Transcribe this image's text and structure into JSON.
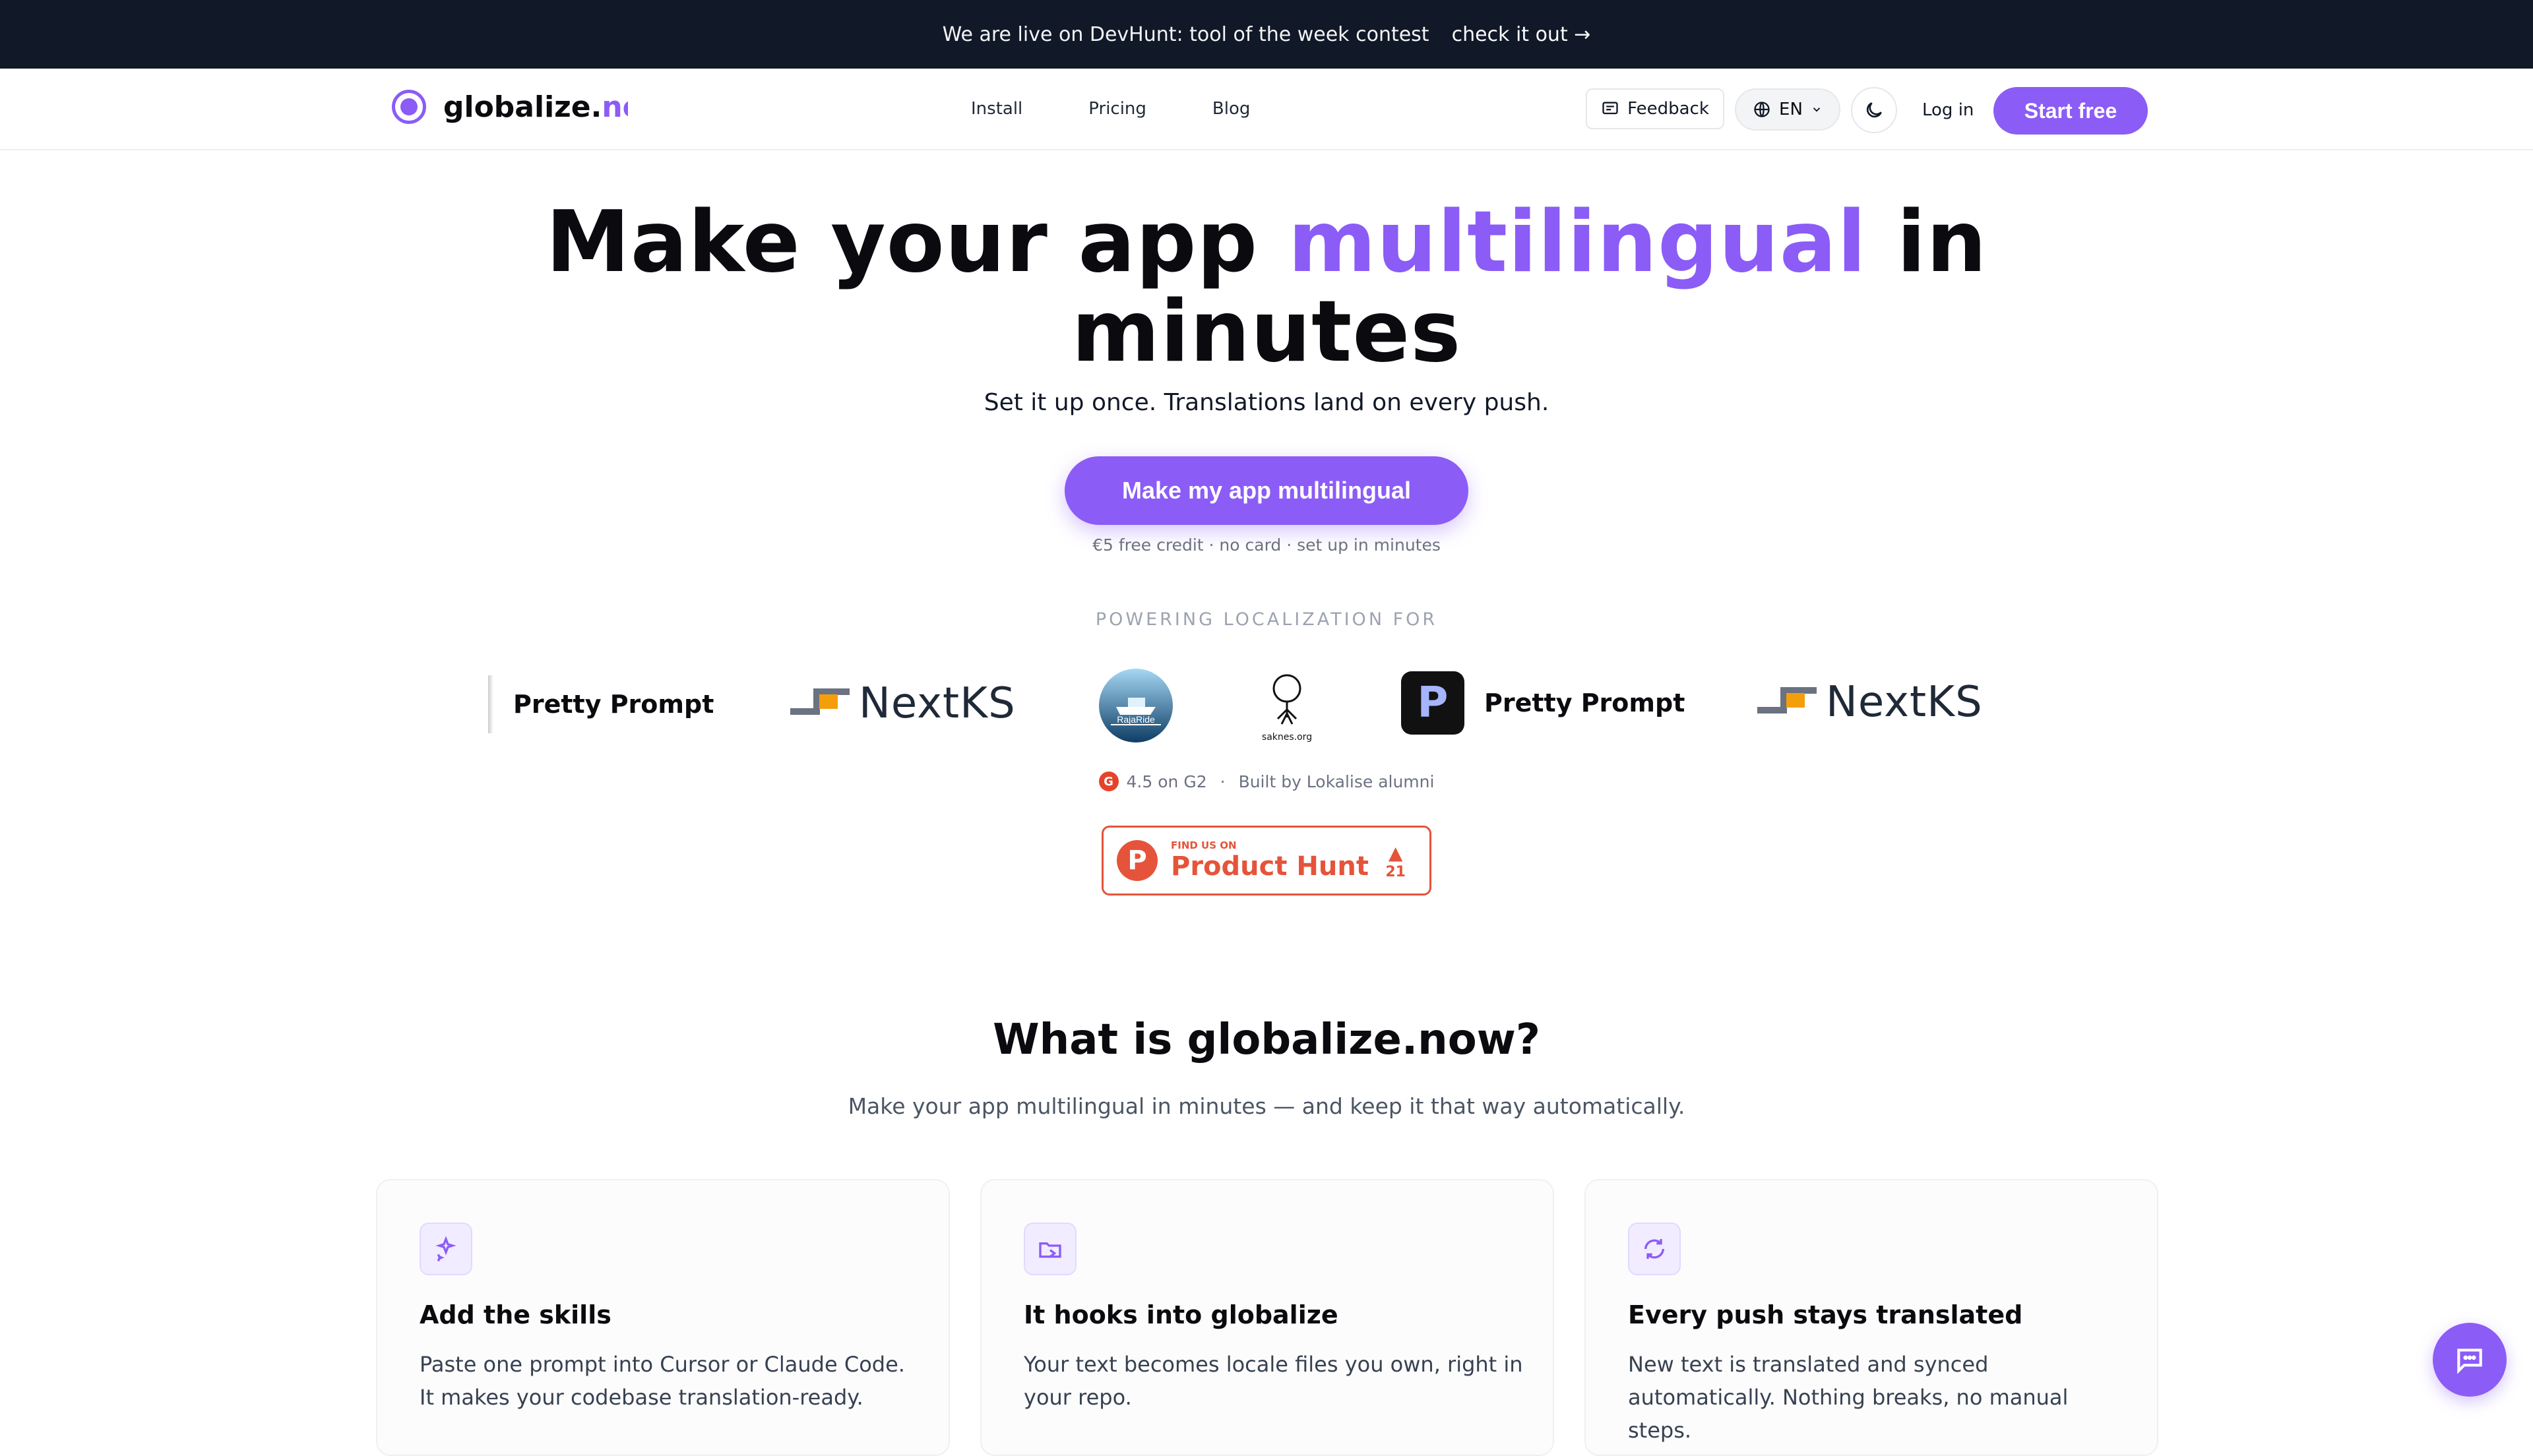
{
  "banner": {
    "text": "We are live on DevHunt: tool of the week contest",
    "link": "check it out →"
  },
  "nav": {
    "logo_text_main": "globalize.",
    "logo_text_accent": "now",
    "links": [
      "Install",
      "Pricing",
      "Blog"
    ],
    "feedback": "Feedback",
    "language": "EN",
    "login": "Log in",
    "start": "Start free"
  },
  "hero": {
    "title_part1": "Make your app ",
    "title_accent": "multilingual",
    "title_part2": " in",
    "title_line2": "minutes",
    "subtitle": "Set it up once. Translations land on every push.",
    "cta": "Make my app multilingual",
    "cta_note": "€5 free credit · no card · set up in minutes"
  },
  "powering": {
    "label": "POWERING LOCALIZATION FOR",
    "logos": [
      "Pretty Prompt",
      "NextKS",
      "RajaRide",
      "saknes.org",
      "Pretty Prompt",
      "NextKS"
    ]
  },
  "ratings": {
    "g2": "4.5 on G2",
    "sep": "·",
    "alumni": "Built by Lokalise alumni"
  },
  "product_hunt": {
    "small": "FIND US ON",
    "big": "Product Hunt",
    "votes": "21"
  },
  "section": {
    "title": "What is globalize.now?",
    "subtitle": "Make your app multilingual in minutes — and keep it that way automatically.",
    "cards": [
      {
        "title": "Add the skills",
        "desc": "Paste one prompt into Cursor or Claude Code. It makes your codebase translation-ready.",
        "icon": "sparkles-icon"
      },
      {
        "title": "It hooks into globalize",
        "desc": "Your text becomes locale files you own, right in your repo.",
        "icon": "folder-hook-icon"
      },
      {
        "title": "Every push stays translated",
        "desc": "New text is translated and synced automatically. Nothing breaks, no manual steps.",
        "icon": "refresh-icon"
      }
    ]
  },
  "colors": {
    "accent": "#8b5cf6",
    "banner": "#111827",
    "product_hunt": "#e5543a"
  }
}
